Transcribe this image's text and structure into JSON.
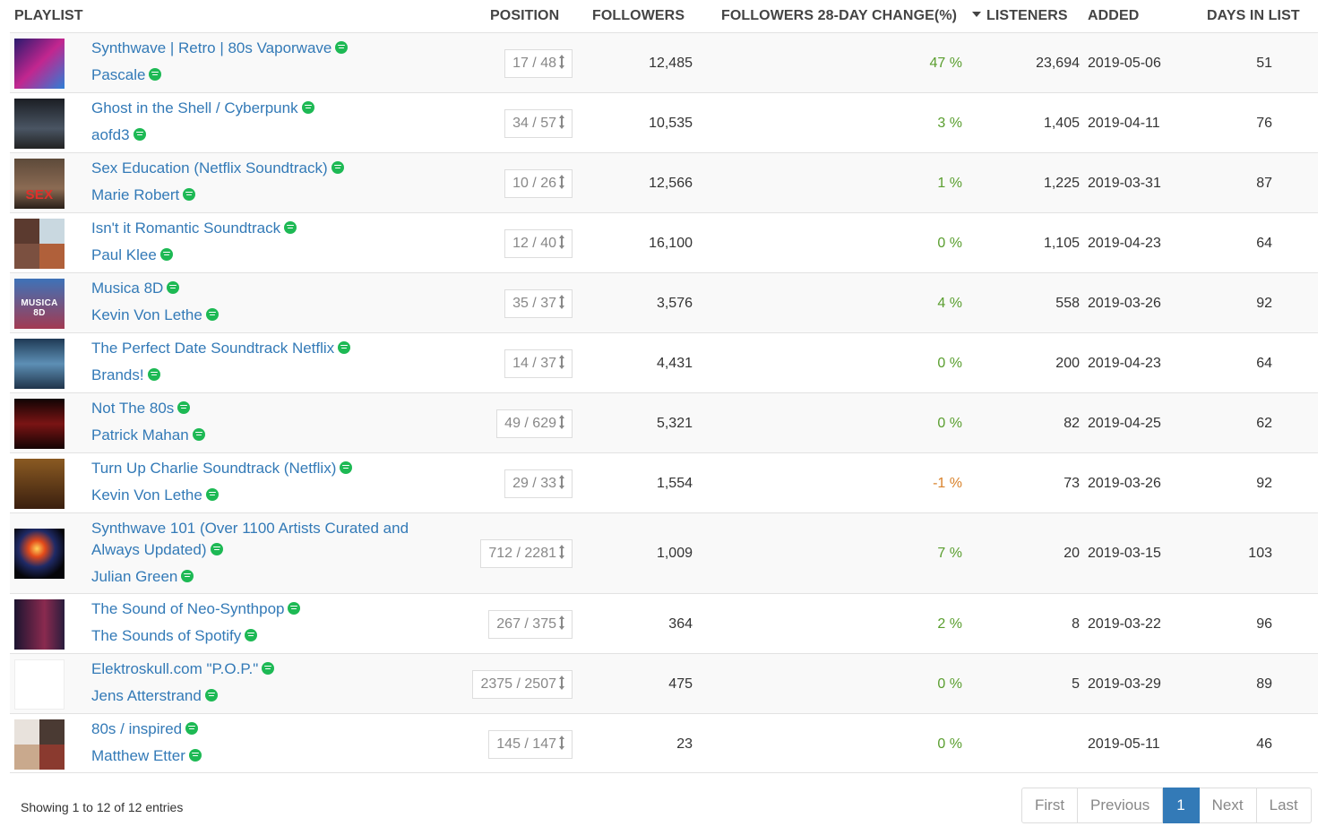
{
  "headers": {
    "playlist": "PLAYLIST",
    "position": "POSITION",
    "followers": "FOLLOWERS",
    "change": "FOLLOWERS 28-DAY CHANGE(%)",
    "listeners": "LISTENERS",
    "added": "ADDED",
    "days": "DAYS IN LIST"
  },
  "colors": {
    "link": "#337ab7",
    "positive": "#5a9e2f",
    "negative": "#d9822b",
    "spotify": "#1db954"
  },
  "rows": [
    {
      "title": "Synthwave | Retro | 80s Vaporwave",
      "owner": "Pascale",
      "position": "17 / 48",
      "followers": "12,485",
      "change": "47 %",
      "listeners": "23,694",
      "added": "2019-05-06",
      "days": "51"
    },
    {
      "title": "Ghost in the Shell / Cyberpunk",
      "owner": "aofd3",
      "position": "34 / 57",
      "followers": "10,535",
      "change": "3 %",
      "listeners": "1,405",
      "added": "2019-04-11",
      "days": "76"
    },
    {
      "title": "Sex Education (Netflix Soundtrack)",
      "owner": "Marie Robert",
      "position": "10 / 26",
      "followers": "12,566",
      "change": "1 %",
      "listeners": "1,225",
      "added": "2019-03-31",
      "days": "87",
      "thumb_text": "SEX"
    },
    {
      "title": "Isn't it Romantic Soundtrack",
      "owner": "Paul Klee",
      "position": "12 / 40",
      "followers": "16,100",
      "change": "0 %",
      "listeners": "1,105",
      "added": "2019-04-23",
      "days": "64"
    },
    {
      "title": "Musica 8D",
      "owner": "Kevin Von Lethe",
      "position": "35 / 37",
      "followers": "3,576",
      "change": "4 %",
      "listeners": "558",
      "added": "2019-03-26",
      "days": "92",
      "thumb_text": "MUSICA 8D"
    },
    {
      "title": "The Perfect Date Soundtrack Netflix",
      "owner": "Brands!",
      "position": "14 / 37",
      "followers": "4,431",
      "change": "0 %",
      "listeners": "200",
      "added": "2019-04-23",
      "days": "64"
    },
    {
      "title": "Not The 80s",
      "owner": "Patrick Mahan",
      "position": "49 / 629",
      "followers": "5,321",
      "change": "0 %",
      "listeners": "82",
      "added": "2019-04-25",
      "days": "62"
    },
    {
      "title": "Turn Up Charlie Soundtrack (Netflix)",
      "owner": "Kevin Von Lethe",
      "position": "29 / 33",
      "followers": "1,554",
      "change": "-1 %",
      "listeners": "73",
      "added": "2019-03-26",
      "days": "92"
    },
    {
      "title": "Synthwave 101 (Over 1100 Artists Curated and Always Updated)",
      "owner": "Julian Green",
      "position": "712 / 2281",
      "followers": "1,009",
      "change": "7 %",
      "listeners": "20",
      "added": "2019-03-15",
      "days": "103"
    },
    {
      "title": "The Sound of Neo-Synthpop",
      "owner": "The Sounds of Spotify",
      "position": "267 / 375",
      "followers": "364",
      "change": "2 %",
      "listeners": "8",
      "added": "2019-03-22",
      "days": "96"
    },
    {
      "title": "Elektroskull.com \"P.O.P.\"",
      "owner": "Jens Atterstrand",
      "position": "2375 / 2507",
      "followers": "475",
      "change": "0 %",
      "listeners": "5",
      "added": "2019-03-29",
      "days": "89"
    },
    {
      "title": "80s / inspired",
      "owner": "Matthew Etter",
      "position": "145 / 147",
      "followers": "23",
      "change": "0 %",
      "listeners": "",
      "added": "2019-05-11",
      "days": "46"
    }
  ],
  "footer": {
    "info": "Showing 1 to 12 of 12 entries",
    "first": "First",
    "previous": "Previous",
    "page": "1",
    "next": "Next",
    "last": "Last"
  }
}
